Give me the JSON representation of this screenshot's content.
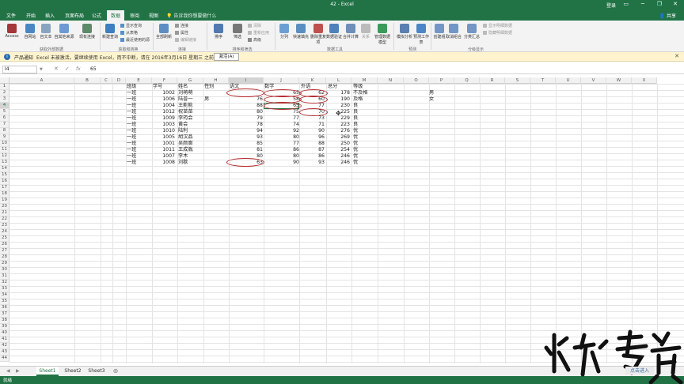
{
  "window": {
    "title": "42 - Excel",
    "login": "登录",
    "controls": [
      "▭",
      "─",
      "❐",
      "✕"
    ]
  },
  "tabs": [
    {
      "label": "文件"
    },
    {
      "label": "开始"
    },
    {
      "label": "插入"
    },
    {
      "label": "页面布局"
    },
    {
      "label": "公式"
    },
    {
      "label": "数据"
    },
    {
      "label": "审阅"
    },
    {
      "label": "视图"
    }
  ],
  "tellme": "告诉我你想要做什么",
  "share": "共享",
  "ribbon": {
    "access": "Access",
    "web": "自网站",
    "text": "自文本",
    "other": "自其他来源",
    "existing": "现有连接",
    "group1": "获取外部数据",
    "newquery": "新建查询",
    "showquery": "显示查询",
    "fromtable": "从表格",
    "recent": "最近使用的源",
    "group2": "获取和转换",
    "refresh": "全部刷新",
    "conn": "连接",
    "props": "属性",
    "editlinks": "编辑链接",
    "group3": "连接",
    "sort": "排序",
    "filter": "筛选",
    "clear": "清除",
    "reapply": "重新应用",
    "advanced": "高级",
    "group4": "排序和筛选",
    "split": "分列",
    "flash": "快速填充",
    "dup": "删除重复项",
    "valid": "数据验证",
    "consol": "合并计算",
    "rel": "关系",
    "manage": "管理数据模型",
    "group5": "数据工具",
    "whatif": "模拟分析",
    "forecast": "预测工作表",
    "group6": "预测",
    "grp": "创建组",
    "ungrp": "取消组合",
    "subtotal": "分类汇总",
    "showd": "显示明细数据",
    "hided": "隐藏明细数据",
    "group7": "分级显示"
  },
  "message": {
    "title": "产品通知",
    "text": "Excel 未被激活。要继续使用 Excel，而不中断，请在 2016年3月16日 星期三 之前激活。",
    "button": "激活(A)"
  },
  "formula": {
    "namebox": "I4",
    "value": "65",
    "fx": "fx"
  },
  "columns": [
    "A",
    "B",
    "C",
    "D",
    "E",
    "F",
    "G",
    "H",
    "I",
    "J",
    "K",
    "L",
    "M",
    "N",
    "O",
    "P",
    "Q",
    "R",
    "S",
    "T",
    "U",
    "V",
    "W",
    "X"
  ],
  "rows": [
    1,
    2,
    3,
    4,
    5,
    6,
    7,
    8,
    9,
    10,
    11,
    12,
    13,
    14,
    15,
    16,
    17,
    18,
    19,
    20,
    21,
    22,
    23,
    24,
    25,
    26,
    27,
    28,
    29,
    30,
    31,
    32,
    33,
    34,
    35,
    36,
    37,
    38,
    39,
    40,
    41,
    42,
    43,
    44
  ],
  "table": {
    "headers": {
      "d": "班级",
      "e": "学号",
      "f": "姓名",
      "g": "性别",
      "h": "语文",
      "i": "数学",
      "j": "外语",
      "k": "总分",
      "l": "等级"
    },
    "data": [
      {
        "d": "一班",
        "e": "1002",
        "f": "刘萌萌",
        "g": "",
        "h": "",
        "i": "65",
        "j": "62",
        "k": "178",
        "l": "不及格"
      },
      {
        "d": "一班",
        "e": "1006",
        "f": "陆普一",
        "g": "男",
        "h": "76",
        "i": "58",
        "j": "60",
        "k": "190",
        "l": "及格"
      },
      {
        "d": "一班",
        "e": "1004",
        "f": "王能能",
        "g": "",
        "h": "88",
        "i": "65",
        "j": "77",
        "k": "230",
        "l": "良"
      },
      {
        "d": "一班",
        "e": "1012",
        "f": "祝苗苗",
        "g": "",
        "h": "80",
        "i": "75",
        "j": "70",
        "k": "225",
        "l": "良"
      },
      {
        "d": "一班",
        "e": "1009",
        "f": "李筠会",
        "g": "",
        "h": "79",
        "i": "77",
        "j": "73",
        "k": "229",
        "l": "良"
      },
      {
        "d": "一班",
        "e": "1003",
        "f": "黄会",
        "g": "",
        "h": "78",
        "i": "74",
        "j": "71",
        "k": "223",
        "l": "良"
      },
      {
        "d": "一班",
        "e": "1010",
        "f": "陆利",
        "g": "",
        "h": "94",
        "i": "92",
        "j": "90",
        "k": "276",
        "l": "优"
      },
      {
        "d": "一班",
        "e": "1005",
        "f": "胡汉品",
        "g": "",
        "h": "93",
        "i": "80",
        "j": "96",
        "k": "269",
        "l": "优"
      },
      {
        "d": "一班",
        "e": "1001",
        "f": "吴颜廓",
        "g": "",
        "h": "85",
        "i": "77",
        "j": "88",
        "k": "250",
        "l": "优"
      },
      {
        "d": "一班",
        "e": "1011",
        "f": "王成胤",
        "g": "",
        "h": "81",
        "i": "86",
        "j": "87",
        "k": "254",
        "l": "优"
      },
      {
        "d": "一班",
        "e": "1007",
        "f": "李木",
        "g": "",
        "h": "80",
        "i": "80",
        "j": "86",
        "k": "246",
        "l": "优"
      },
      {
        "d": "一班",
        "e": "1008",
        "f": "刘歇",
        "g": "",
        "h": "63",
        "i": "90",
        "j": "93",
        "k": "246",
        "l": "优"
      }
    ],
    "o2": "男",
    "o3": "女"
  },
  "sheets": [
    {
      "label": "Sheet1"
    },
    {
      "label": "Sheet2"
    },
    {
      "label": "Sheet3"
    }
  ],
  "status": "就绪",
  "watermark": {
    "text": "水利考资",
    "sub": "点击进入"
  },
  "colors": {
    "excel_green": "#217346",
    "annotation_red": "#b5282c",
    "message_bar": "#fff4ce"
  }
}
